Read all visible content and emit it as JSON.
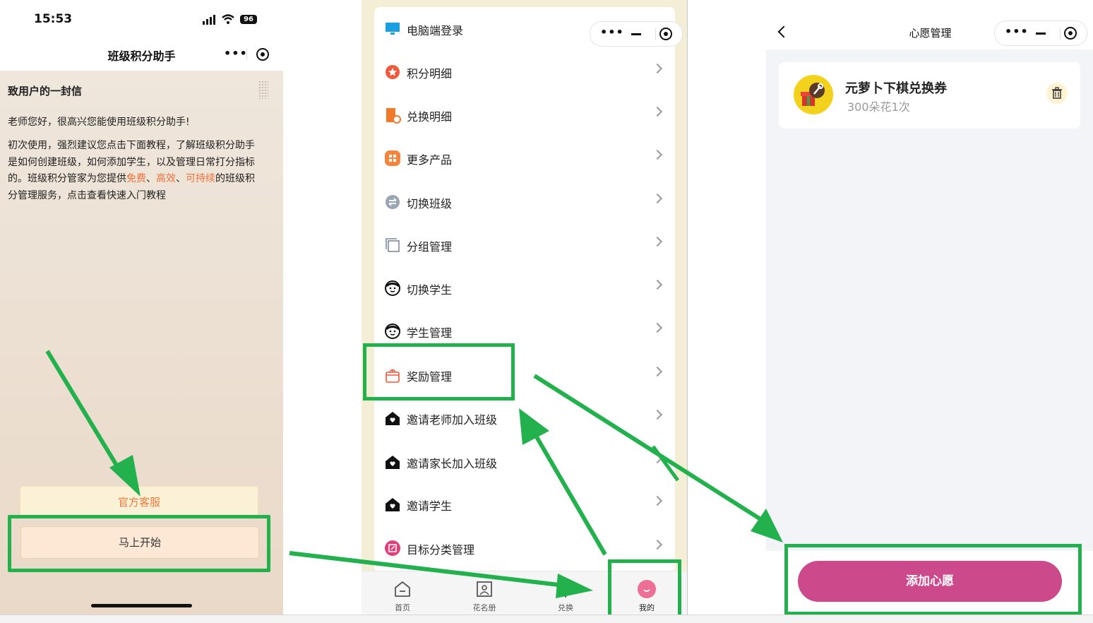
{
  "panel1": {
    "status": {
      "time": "15:53",
      "battery": "96"
    },
    "nav_title": "班级积分助手",
    "letter": {
      "title": "致用户的一封信",
      "greeting": "老师您好，很高兴您能使用班级积分助手!",
      "body_parts": {
        "p1": "初次使用，强烈建议您点击下面教程，了解班级积分助手是如何创建班级，如何添加学生，以及管理日常打分指标的。班级积分管家为您提供",
        "hl1": "免费",
        "sep1": "、",
        "hl2": "高效",
        "sep2": "、",
        "hl3": "可持续",
        "p2": "的班级积分管理服务，点击查看快速入门教程"
      }
    },
    "buttons": {
      "service": "官方客服",
      "start": "马上开始"
    }
  },
  "panel2": {
    "menu": [
      {
        "label": "电脑端登录",
        "icon": "monitor-icon"
      },
      {
        "label": "积分明细",
        "icon": "points-icon"
      },
      {
        "label": "兑换明细",
        "icon": "gift-list-icon"
      },
      {
        "label": "更多产品",
        "icon": "grid-apps-icon"
      },
      {
        "label": "切换班级",
        "icon": "switch-icon"
      },
      {
        "label": "分组管理",
        "icon": "group-icon"
      },
      {
        "label": "切换学生",
        "icon": "student-face-icon"
      },
      {
        "label": "学生管理",
        "icon": "student-face-icon"
      },
      {
        "label": "奖励管理",
        "icon": "reward-box-icon"
      },
      {
        "label": "邀请老师加入班级",
        "icon": "house-heart-icon"
      },
      {
        "label": "邀请家长加入班级",
        "icon": "house-heart-icon"
      },
      {
        "label": "邀请学生",
        "icon": "house-heart-icon"
      },
      {
        "label": "目标分类管理",
        "icon": "edit-category-icon"
      }
    ],
    "tabs": [
      {
        "label": "首页",
        "icon": "home-icon"
      },
      {
        "label": "花名册",
        "icon": "roster-icon"
      },
      {
        "label": "兑换",
        "icon": "exchange-icon"
      },
      {
        "label": "我的",
        "icon": "smile-icon"
      }
    ]
  },
  "panel3": {
    "nav_title": "心愿管理",
    "wish": {
      "name": "元萝卜下棋兑换券",
      "cost": "300朵花1次"
    },
    "add_button": "添加心愿"
  },
  "colors": {
    "annotation_green": "#22b14c",
    "accent_orange": "#f0713a",
    "wish_button": "#cc4a8b",
    "menu_bg": "#f5eed7"
  }
}
